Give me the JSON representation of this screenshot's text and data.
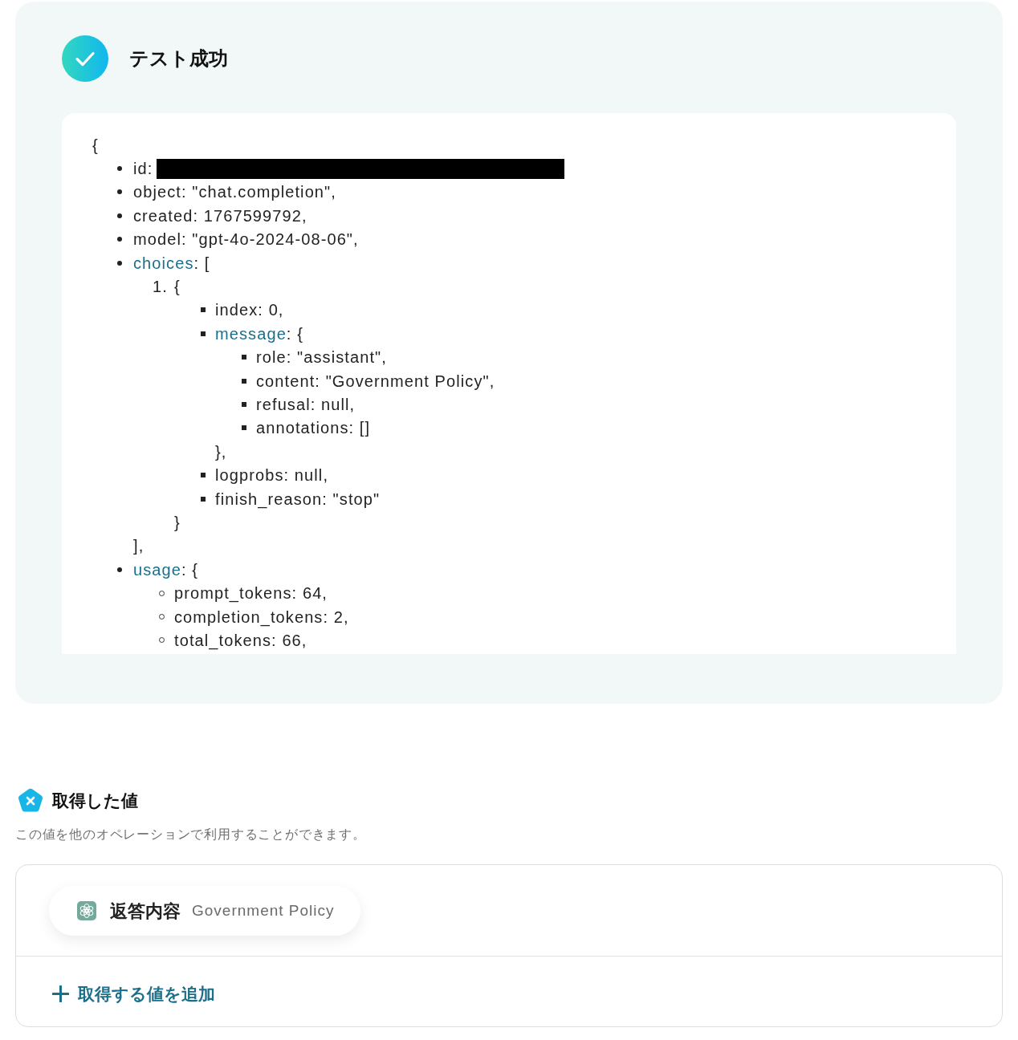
{
  "result": {
    "title": "テスト成功",
    "output": {
      "open": "{",
      "items": [
        {
          "kind": "redacted",
          "key": "id:"
        },
        {
          "kind": "field",
          "key": "object",
          "text": ": \"chat.completion\","
        },
        {
          "kind": "field",
          "key": "created",
          "text": ": 1767599792,"
        },
        {
          "kind": "field",
          "key": "model",
          "text": ": \"gpt-4o-2024-08-06\","
        },
        {
          "kind": "group",
          "key": "choices",
          "text": ": [",
          "close": "],",
          "children": [
            {
              "kind": "entry",
              "marker": "1.",
              "text": "{",
              "close": "}",
              "children": [
                {
                  "kind": "field",
                  "key": "index",
                  "text": ": 0,"
                },
                {
                  "kind": "group",
                  "key": "message",
                  "text": ": {",
                  "close": "},",
                  "children": [
                    {
                      "kind": "field",
                      "key": "role",
                      "text": ": \"assistant\","
                    },
                    {
                      "kind": "field",
                      "key": "content",
                      "text": ": \"Government Policy\","
                    },
                    {
                      "kind": "field",
                      "key": "refusal",
                      "text": ": null,"
                    },
                    {
                      "kind": "field",
                      "key": "annotations",
                      "text": ": []"
                    }
                  ]
                },
                {
                  "kind": "field",
                  "key": "logprobs",
                  "text": ": null,"
                },
                {
                  "kind": "field",
                  "key": "finish_reason",
                  "text": ": \"stop\""
                }
              ]
            }
          ]
        },
        {
          "kind": "group",
          "key": "usage",
          "text": ": {",
          "children": [
            {
              "kind": "field",
              "key": "prompt_tokens",
              "text": ": 64,"
            },
            {
              "kind": "field",
              "key": "completion_tokens",
              "text": ": 2,"
            },
            {
              "kind": "field",
              "key": "total_tokens",
              "text": ": 66,"
            }
          ]
        }
      ]
    }
  },
  "obtained": {
    "title": "取得した値",
    "description": "この値を他のオペレーションで利用することができます。",
    "values": [
      {
        "label": "返答内容",
        "value": "Government Policy"
      }
    ],
    "add_button": "取得する値を追加"
  }
}
